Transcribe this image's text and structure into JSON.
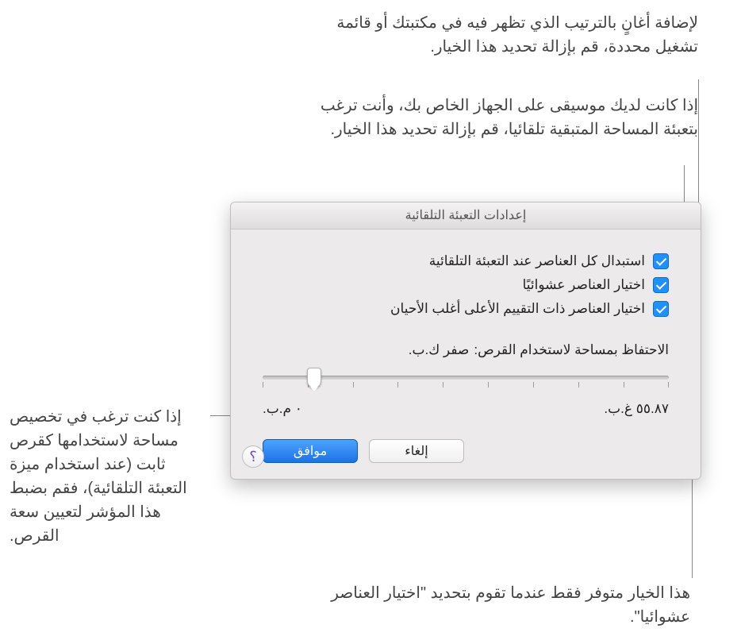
{
  "callouts": {
    "top1": "لإضافة أغانٍ بالترتيب الذي تظهر فيه في مكتبتك أو قائمة تشغيل محددة، قم بإزالة تحديد هذا الخيار.",
    "top2": "إذا كانت لديك موسيقى على الجهاز الخاص بك، وأنت ترغب بتعبئة المساحة المتبقية تلقائيا، قم بإزالة تحديد هذا الخيار.",
    "left": "إذا كنت ترغب في تخصيص مساحة لاستخدامها كقرص ثابت (عند استخدام ميزة التعبئة التلقائية)، فقم بضبط هذا المؤشر لتعيين سعة القرص.",
    "bottom": "هذا الخيار متوفر فقط عندما تقوم بتحديد \"اختيار العناصر عشوائيا\"."
  },
  "dialog": {
    "title": "إعدادات التعبئة التلقائية",
    "checks": {
      "c1": "استبدال كل العناصر عند التعبئة التلقائية",
      "c2": "اختيار العناصر عشوائيًا",
      "c3": "اختيار العناصر ذات التقييم الأعلى أغلب الأحيان"
    },
    "reserve_label": "الاحتفاظ بمساحة لاستخدام القرص:",
    "reserve_value": "صفر ك.ب.",
    "slider_min": "٠ م.ب.",
    "slider_max": "٥٥.٨٧ غ.ب.",
    "ok": "موافق",
    "cancel": "إلغاء",
    "help": "؟"
  }
}
